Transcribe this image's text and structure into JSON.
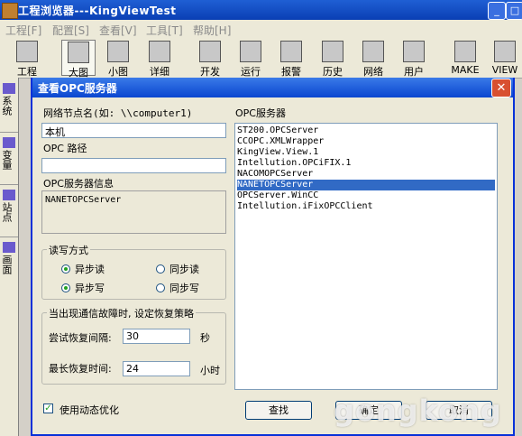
{
  "window": {
    "title": "工程浏览器---KingViewTest"
  },
  "menu": [
    "工程[F]",
    "配置[S]",
    "查看[V]",
    "工具[T]",
    "帮助[H]"
  ],
  "toolbar": [
    "工程",
    "大图",
    "小图",
    "详细",
    "开发",
    "运行",
    "报警",
    "历史",
    "网络",
    "用户",
    "MAKE",
    "VIEW"
  ],
  "sidebar": [
    "系统",
    "变量",
    "站点",
    "画面"
  ],
  "dialog": {
    "title": "查看OPC服务器",
    "node_label": "网络节点名(如: \\\\computer1)",
    "node_value": "本机",
    "opc_path_label": "OPC 路径",
    "opc_path_value": "",
    "info_label": "OPC服务器信息",
    "info_value": "NANETOPCServer",
    "rw_group": "读写方式",
    "rw_options": [
      "异步读",
      "同步读",
      "异步写",
      "同步写"
    ],
    "recovery_group": "当出现通信故障时, 设定恢复策略",
    "retry_label": "尝试恢复间隔:",
    "retry_value": "30",
    "retry_unit": "秒",
    "max_label": "最长恢复时间:",
    "max_value": "24",
    "max_unit": "小时",
    "dynamic_label": "使用动态优化",
    "servers_label": "OPC服务器",
    "servers": [
      "ST200.OPCServer",
      "CCOPC.XMLWrapper",
      "KingView.View.1",
      "Intellution.OPCiFIX.1",
      "NACOMOPCServer",
      "NANETOPCServer",
      "OPCServer.WinCC",
      "Intellution.iFixOPCClient"
    ],
    "find_button": "查找",
    "ok_button": "确定",
    "cancel_button": "取消"
  },
  "watermark": "gongkong"
}
